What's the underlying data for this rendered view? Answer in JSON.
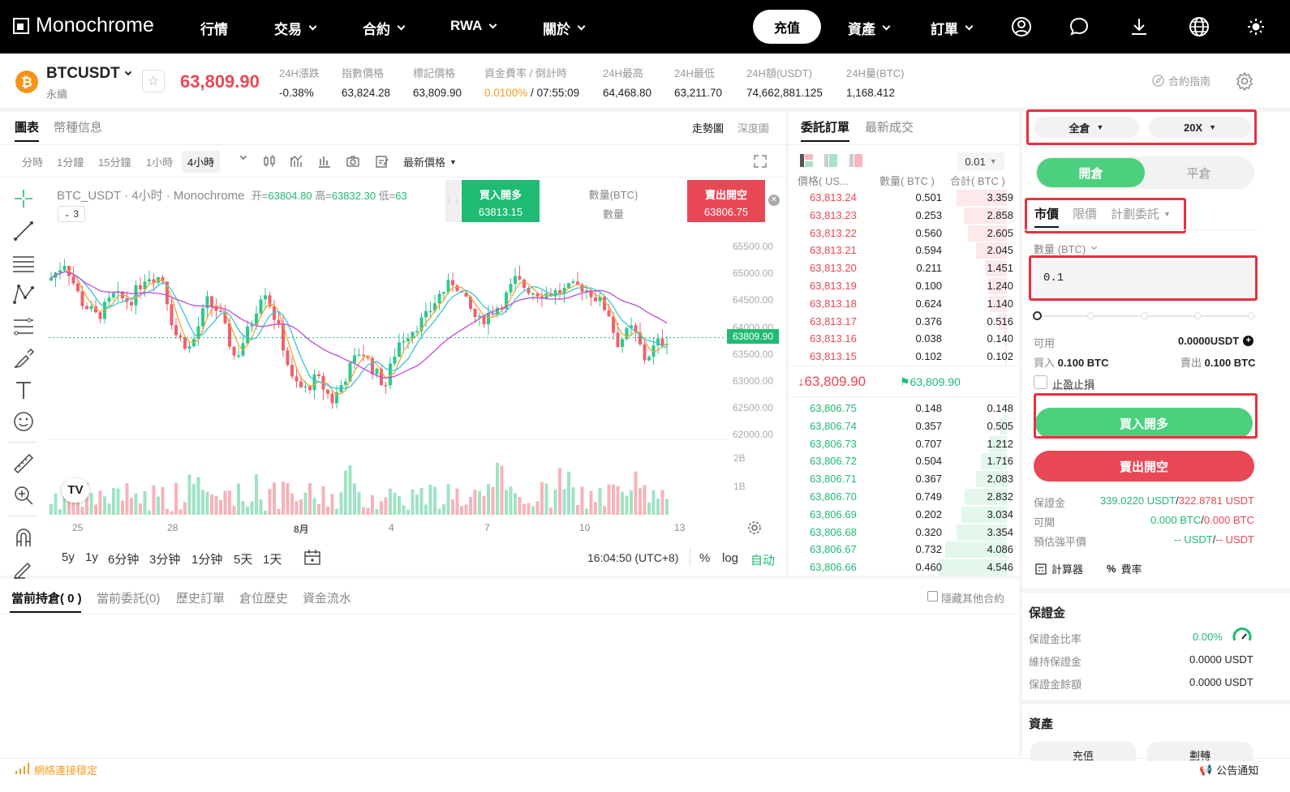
{
  "nav": {
    "brand": "Monochrome",
    "items": [
      "行情",
      "交易",
      "合約",
      "RWA",
      "關於"
    ],
    "recharge": "充值",
    "assets": "資產",
    "orders": "訂單"
  },
  "ticker": {
    "symbol": "BTCUSDT",
    "type": "永續",
    "last_price": "63,809.90",
    "stats": [
      {
        "label": "24H漲跌",
        "value": "-0.38%"
      },
      {
        "label": "指數價格",
        "value": "63,824.28"
      },
      {
        "label": "標記價格",
        "value": "63,809.90"
      },
      {
        "label": "資金費率 / 倒計時",
        "value_rate": "0.0100%",
        "value_time": "07:55:09"
      },
      {
        "label": "24H最高",
        "value": "64,468.80"
      },
      {
        "label": "24H最低",
        "value": "63,211.70"
      },
      {
        "label": "24H額(USDT)",
        "value": "74,662,881.125"
      },
      {
        "label": "24H量(BTC)",
        "value": "1,168.412"
      }
    ],
    "guide": "合約指南"
  },
  "chart_panel": {
    "tabs": [
      "圖表",
      "幣種信息"
    ],
    "view_tabs": [
      "走勢圖",
      "深度圖"
    ],
    "intervals": [
      "分時",
      "1分鐘",
      "15分鐘",
      "1小時",
      "4小時"
    ],
    "price_type": "最新價格",
    "legend": "BTC_USDT · 4小时 · Monochrome",
    "ohlc": {
      "open_label": "开=",
      "open": "63804.80",
      "high_label": "高=",
      "high": "63832.30",
      "low_label": "低=",
      "low": "63"
    },
    "indicator_count": "3",
    "buy_box": {
      "label": "買入開多",
      "price": "63813.15"
    },
    "sell_box": {
      "label": "賣出開空",
      "price": "63806.75"
    },
    "qty_label": "數量(BTC)",
    "qty_sub": "數量",
    "price_axis": [
      "65500.00",
      "65000.00",
      "64500.00",
      "64000.00",
      "63500.00",
      "63000.00",
      "62500.00",
      "62000.00"
    ],
    "current_price_tag": "63809.90",
    "volume_axis": [
      "2B",
      "1B"
    ],
    "time_axis": [
      "25",
      "28",
      "8月",
      "4",
      "7",
      "10",
      "13"
    ],
    "ranges": [
      "5y",
      "1y",
      "6分钟",
      "3分钟",
      "1分钟",
      "5天",
      "1天"
    ],
    "clock": "16:04:50 (UTC+8)",
    "pct": "%",
    "log": "log",
    "auto": "自动"
  },
  "orderbook": {
    "tabs": [
      "委託訂單",
      "最新成交"
    ],
    "precision": "0.01",
    "headers": [
      "價格( US...",
      "數量( BTC )",
      "合計( BTC )"
    ],
    "asks": [
      [
        "63,813.24",
        "0.501",
        "3.359"
      ],
      [
        "63,813.23",
        "0.253",
        "2.858"
      ],
      [
        "63,813.22",
        "0.560",
        "2.605"
      ],
      [
        "63,813.21",
        "0.594",
        "2.045"
      ],
      [
        "63,813.20",
        "0.211",
        "1.451"
      ],
      [
        "63,813.19",
        "0.100",
        "1.240"
      ],
      [
        "63,813.18",
        "0.624",
        "1.140"
      ],
      [
        "63,813.17",
        "0.376",
        "0.516"
      ],
      [
        "63,813.16",
        "0.038",
        "0.140"
      ],
      [
        "63,813.15",
        "0.102",
        "0.102"
      ]
    ],
    "mid_price": "63,809.90",
    "mark_price": "63,809.90",
    "bids": [
      [
        "63,806.75",
        "0.148",
        "0.148"
      ],
      [
        "63,806.74",
        "0.357",
        "0.505"
      ],
      [
        "63,806.73",
        "0.707",
        "1.212"
      ],
      [
        "63,806.72",
        "0.504",
        "1.716"
      ],
      [
        "63,806.71",
        "0.367",
        "2.083"
      ],
      [
        "63,806.70",
        "0.749",
        "2.832"
      ],
      [
        "63,806.69",
        "0.202",
        "3.034"
      ],
      [
        "63,806.68",
        "0.320",
        "3.354"
      ],
      [
        "63,806.67",
        "0.732",
        "4.086"
      ],
      [
        "63,806.66",
        "0.460",
        "4.546"
      ]
    ]
  },
  "order_form": {
    "margin_mode": "全倉",
    "leverage": "20X",
    "open": "開倉",
    "close": "平倉",
    "types": [
      "市價",
      "限價",
      "計劃委託"
    ],
    "qty_label": "數量 (BTC)",
    "qty_value": "0.1",
    "available_label": "可用",
    "available_value": "0.0000USDT",
    "buy_label": "買入",
    "buy_value": "0.100 BTC",
    "sell_label": "賣出",
    "sell_value": "0.100 BTC",
    "tpsl": "止盈止損",
    "buy_button": "買入開多",
    "sell_button": "賣出開空",
    "margin_label": "保證金",
    "margin_buy": "339.0220 USDT",
    "margin_sell": "322.8781 USDT",
    "avail_label": "可開",
    "avail_buy": "0.000 BTC",
    "avail_sell": "0.000 BTC",
    "liq_label": "預估強平價",
    "liq_buy": "-- USDT",
    "liq_sell": "-- USDT",
    "calculator": "計算器",
    "fee": "費率"
  },
  "margin_section": {
    "title": "保證金",
    "rows": [
      {
        "label": "保證金比率",
        "value": "0.00%"
      },
      {
        "label": "維持保證金",
        "value": "0.0000 USDT"
      },
      {
        "label": "保證金餘額",
        "value": "0.0000 USDT"
      }
    ]
  },
  "assets_section": {
    "title": "資產",
    "deposit": "充值",
    "transfer": "劃轉"
  },
  "positions": {
    "tabs": [
      "當前持倉( 0 )",
      "當前委託(0)",
      "歷史訂單",
      "倉位歷史",
      "資金流水"
    ],
    "hide_other": "隱藏其他合約"
  },
  "footer": {
    "network": "網絡連接穩定",
    "notice": "公告通知"
  },
  "colors": {
    "up": "#1fbb73",
    "down": "#e84855",
    "accent": "#f0a020",
    "black": "#000000"
  }
}
